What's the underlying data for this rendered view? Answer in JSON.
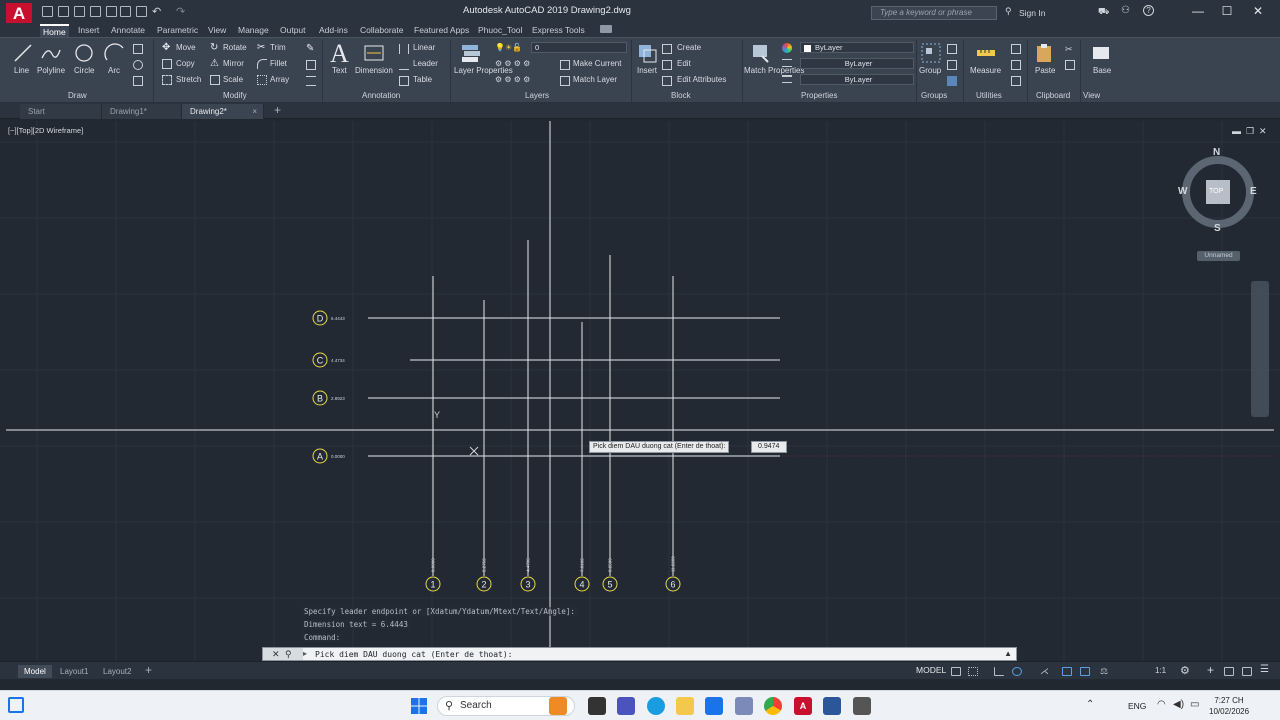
{
  "window": {
    "title": "Autodesk AutoCAD 2019     Drawing2.dwg",
    "search_placeholder": "Type a keyword or phrase",
    "sign_in": "Sign In",
    "minimize": "—",
    "maximize": "☐",
    "close": "✕",
    "logo": "A"
  },
  "ribbon_tabs": [
    "Home",
    "Insert",
    "Annotate",
    "Parametric",
    "View",
    "Manage",
    "Output",
    "Add-ins",
    "Collaborate",
    "Featured Apps",
    "Phuoc_Tool",
    "Express Tools"
  ],
  "ribbon": {
    "draw": {
      "title": "Draw",
      "line": "Line",
      "polyline": "Polyline",
      "circle": "Circle",
      "arc": "Arc"
    },
    "modify": {
      "title": "Modify",
      "move": "Move",
      "rotate": "Rotate",
      "trim": "Trim",
      "copy": "Copy",
      "mirror": "Mirror",
      "fillet": "Fillet",
      "stretch": "Stretch",
      "scale": "Scale",
      "array": "Array"
    },
    "annotation": {
      "title": "Annotation",
      "text": "Text",
      "dimension": "Dimension",
      "linear": "Linear",
      "leader": "Leader",
      "table": "Table"
    },
    "layers": {
      "title": "Layers",
      "layer_properties": "Layer Properties",
      "make_current": "Make Current",
      "match_layer": "Match Layer",
      "current_layer": "0"
    },
    "block": {
      "title": "Block",
      "insert": "Insert",
      "create": "Create",
      "edit": "Edit",
      "edit_attributes": "Edit Attributes"
    },
    "properties": {
      "title": "Properties",
      "match_properties": "Match Properties",
      "color": "ByLayer",
      "linetype": "ByLayer",
      "lineweight": "ByLayer"
    },
    "groups": {
      "title": "Groups",
      "group": "Group"
    },
    "utilities": {
      "title": "Utilities",
      "measure": "Measure"
    },
    "clipboard": {
      "title": "Clipboard",
      "paste": "Paste"
    },
    "view": {
      "title": "View",
      "base": "Base"
    }
  },
  "file_tabs": [
    "Start",
    "Drawing1*",
    "Drawing2*"
  ],
  "viewport": {
    "label": "[−][Top][2D Wireframe]",
    "viewcube": {
      "n": "N",
      "s": "S",
      "e": "E",
      "w": "W",
      "face": "TOP"
    },
    "ucs_name": "Unnamed"
  },
  "grid": {
    "rows": [
      {
        "label": "D",
        "value": "6.4443"
      },
      {
        "label": "C",
        "value": "4.4734"
      },
      {
        "label": "B",
        "value": "2.8923"
      },
      {
        "label": "A",
        "value": "0.0000"
      }
    ],
    "columns": [
      {
        "label": "1",
        "value": "0.0000"
      },
      {
        "label": "2",
        "value": "2.2752"
      },
      {
        "label": "3",
        "value": "4.4798"
      },
      {
        "label": "4",
        "value": "7.0102"
      },
      {
        "label": "5",
        "value": "8.2580"
      },
      {
        "label": "6",
        "value": "11.2280"
      }
    ]
  },
  "tooltip": {
    "prompt": "Pick diem DAU duong cat (Enter de thoat):",
    "value": "0.9474"
  },
  "command_history": [
    "Specify leader endpoint or [Xdatum/Ydatum/Mtext/Text/Angle]:",
    "Dimension text = 6.4443",
    "Command:"
  ],
  "command_line": "Pick diem DAU duong cat (Enter de thoat):",
  "layout_tabs": [
    "Model",
    "Layout1",
    "Layout2"
  ],
  "status": {
    "model": "MODEL",
    "scale": "1:1"
  },
  "taskbar": {
    "search": "Search",
    "lang": "ENG",
    "time": "7:27 CH",
    "date": "10/02/2026"
  }
}
